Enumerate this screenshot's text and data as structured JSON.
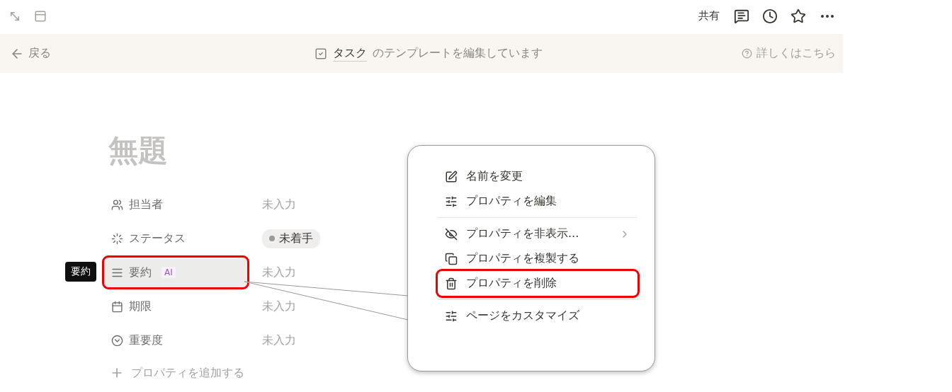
{
  "top_bar": {
    "share": "共有"
  },
  "template_banner": {
    "back": "戻る",
    "database": "タスク",
    "message": "のテンプレートを編集しています",
    "help": "詳しくはこちら"
  },
  "page": {
    "title": "無題",
    "properties": [
      {
        "kind": "person",
        "name": "担当者",
        "value": "未入力",
        "highlighted": false
      },
      {
        "kind": "status",
        "name": "ステータス",
        "value": "未着手",
        "highlighted": false
      },
      {
        "kind": "text",
        "name": "要約",
        "badge": "AI",
        "tooltip": "要約",
        "value": "未入力",
        "highlighted": true
      },
      {
        "kind": "date",
        "name": "期限",
        "value": "未入力",
        "highlighted": false
      },
      {
        "kind": "select",
        "name": "重要度",
        "value": "未入力",
        "highlighted": false
      }
    ],
    "add_property": "プロパティを追加する"
  },
  "callout_menu": {
    "groups": [
      [
        {
          "kind": "rename",
          "label": "名前を変更",
          "submenu": false,
          "highlighted": false
        },
        {
          "kind": "edit",
          "label": "プロパティを編集",
          "submenu": false,
          "highlighted": false
        }
      ],
      [
        {
          "kind": "hide",
          "label": "プロパティを非表示...",
          "submenu": true,
          "highlighted": false
        },
        {
          "kind": "duplicate",
          "label": "プロパティを複製する",
          "submenu": false,
          "highlighted": false
        },
        {
          "kind": "delete",
          "label": "プロパティを削除",
          "submenu": false,
          "highlighted": true
        }
      ],
      [
        {
          "kind": "customize",
          "label": "ページをカスタマイズ",
          "submenu": false,
          "highlighted": false
        }
      ]
    ]
  }
}
